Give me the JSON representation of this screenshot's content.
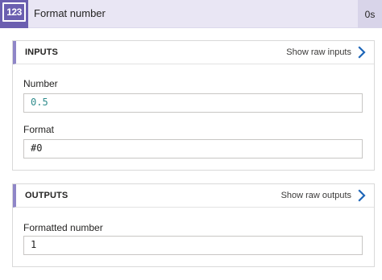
{
  "header": {
    "icon_text": "123",
    "title": "Format number",
    "duration": "0s"
  },
  "inputs": {
    "title": "INPUTS",
    "raw_link": "Show raw inputs",
    "fields": [
      {
        "label": "Number",
        "value": "0.5"
      },
      {
        "label": "Format",
        "value": "#0"
      }
    ]
  },
  "outputs": {
    "title": "OUTPUTS",
    "raw_link": "Show raw outputs",
    "fields": [
      {
        "label": "Formatted number",
        "value": "1"
      }
    ]
  },
  "colors": {
    "accent": "#6b5fb0",
    "header_bg": "#e9e6f4",
    "section_accent": "#8f86c8",
    "link_chevron": "#1e66b8"
  },
  "icons": {
    "action": "number-format-icon",
    "chevron": "chevron-right-icon"
  }
}
